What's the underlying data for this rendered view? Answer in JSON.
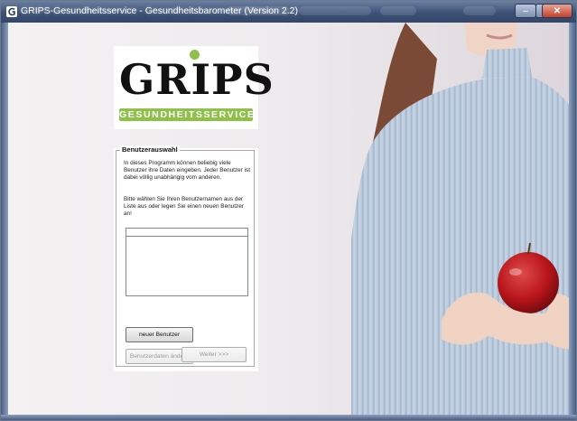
{
  "window": {
    "title": "GRIPS-Gesundheitsservice - Gesundheitsbarometer (Version 2.2)",
    "minimize_glyph": "–",
    "maximize_glyph": "□",
    "close_glyph": "✕"
  },
  "logo": {
    "wordmark": "GRIPS",
    "tagline": "GESUNDHEITSSERVICE"
  },
  "user_selection": {
    "legend": "Benutzerauswahl",
    "intro": "In dieses Programm können beliebig viele Benutzer ihre Daten eingeben. Jeder Benutzer ist dabei völlig unabhängig vom anderen.",
    "instruction": "Bitte wählen Sie Ihren Benutzernamen aus der Liste aus oder legen Sie einen neuen Benutzer an!",
    "users": [],
    "new_user_label": "neuer Benutzer",
    "edit_user_label": "Benutzerdaten ändern",
    "next_label": "Weiter >>>"
  },
  "colors": {
    "brand_green": "#8fc14a",
    "titlebar": "#3d5277"
  }
}
